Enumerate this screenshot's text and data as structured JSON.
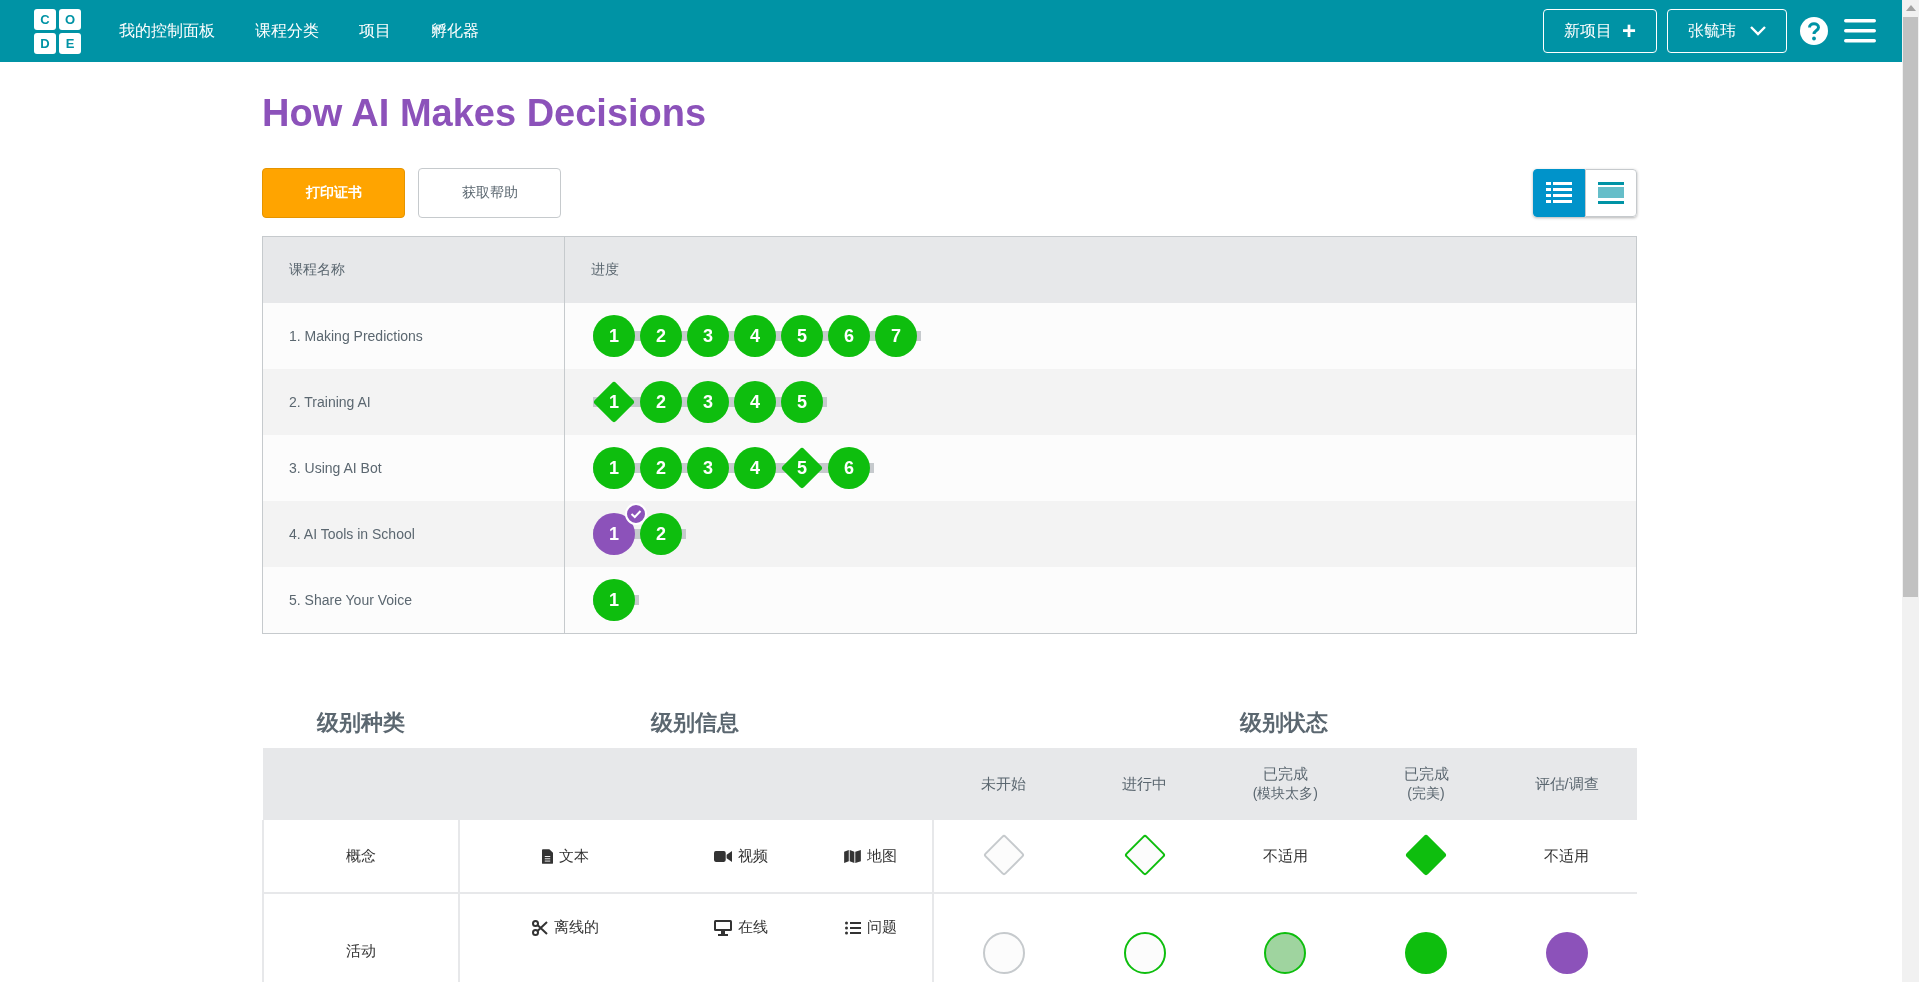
{
  "header": {
    "logo_letters": [
      "C",
      "O",
      "D",
      "E"
    ],
    "nav": [
      "我的控制面板",
      "课程分类",
      "项目",
      "孵化器"
    ],
    "new_project": {
      "label": "新项目",
      "icon": "+"
    },
    "user": {
      "label": "张毓玮"
    }
  },
  "title": "How AI Makes Decisions",
  "actions": {
    "print": "打印证书",
    "help": "获取帮助"
  },
  "view_toggle": [
    {
      "kind": "detail",
      "selected": true
    },
    {
      "kind": "summary",
      "selected": false
    }
  ],
  "progress_table": {
    "columns": [
      "课程名称",
      "进度"
    ],
    "lessons": [
      {
        "name": "1. Making Predictions",
        "levels": [
          {
            "number": "1",
            "kind": "circle",
            "color": "#0ebe0e",
            "checked": false
          },
          {
            "number": "2",
            "kind": "circle",
            "color": "#0ebe0e",
            "checked": false
          },
          {
            "number": "3",
            "kind": "circle",
            "color": "#0ebe0e",
            "checked": false
          },
          {
            "number": "4",
            "kind": "circle",
            "color": "#0ebe0e",
            "checked": false
          },
          {
            "number": "5",
            "kind": "circle",
            "color": "#0ebe0e",
            "checked": false
          },
          {
            "number": "6",
            "kind": "circle",
            "color": "#0ebe0e",
            "checked": false
          },
          {
            "number": "7",
            "kind": "circle",
            "color": "#0ebe0e",
            "checked": false
          }
        ]
      },
      {
        "name": "2. Training AI",
        "levels": [
          {
            "number": "1",
            "kind": "diamond",
            "color": "#0ebe0e",
            "checked": false
          },
          {
            "number": "2",
            "kind": "circle",
            "color": "#0ebe0e",
            "checked": false
          },
          {
            "number": "3",
            "kind": "circle",
            "color": "#0ebe0e",
            "checked": false
          },
          {
            "number": "4",
            "kind": "circle",
            "color": "#0ebe0e",
            "checked": false
          },
          {
            "number": "5",
            "kind": "circle",
            "color": "#0ebe0e",
            "checked": false
          }
        ]
      },
      {
        "name": "3. Using AI Bot",
        "levels": [
          {
            "number": "1",
            "kind": "circle",
            "color": "#0ebe0e",
            "checked": false
          },
          {
            "number": "2",
            "kind": "circle",
            "color": "#0ebe0e",
            "checked": false
          },
          {
            "number": "3",
            "kind": "circle",
            "color": "#0ebe0e",
            "checked": false
          },
          {
            "number": "4",
            "kind": "circle",
            "color": "#0ebe0e",
            "checked": false
          },
          {
            "number": "5",
            "kind": "diamond",
            "color": "#0ebe0e",
            "checked": false
          },
          {
            "number": "6",
            "kind": "circle",
            "color": "#0ebe0e",
            "checked": false
          }
        ]
      },
      {
        "name": "4. AI Tools in School",
        "levels": [
          {
            "number": "1",
            "kind": "circle",
            "color": "#8c52ba",
            "checked": true
          },
          {
            "number": "2",
            "kind": "circle",
            "color": "#0ebe0e",
            "checked": false
          }
        ]
      },
      {
        "name": "5. Share Your Voice",
        "levels": [
          {
            "number": "1",
            "kind": "circle",
            "color": "#0ebe0e",
            "checked": false
          }
        ]
      }
    ]
  },
  "legend": {
    "headings": [
      "级别种类",
      "级别信息",
      "级别状态"
    ],
    "status_columns": [
      {
        "label": "未开始"
      },
      {
        "label": "进行中"
      },
      {
        "label": "已完成",
        "note": "(模块太多)"
      },
      {
        "label": "已完成",
        "note": "(完美)"
      },
      {
        "label": "评估/调查"
      }
    ],
    "rows": [
      {
        "type": "概念",
        "info": [
          {
            "kind": "document",
            "label": "文本"
          },
          {
            "kind": "video",
            "label": "视频"
          },
          {
            "kind": "map",
            "label": "地图"
          }
        ],
        "statuses": [
          {
            "kind": "diamond"
          },
          {
            "kind": "diamond"
          },
          {
            "kind": "text",
            "text": "不适用"
          },
          {
            "kind": "diamond"
          },
          {
            "kind": "text",
            "text": "不适用"
          }
        ]
      },
      {
        "type": "活动",
        "info": [
          {
            "kind": "offline",
            "label": "离线的"
          },
          {
            "kind": "online",
            "label": "在线"
          },
          {
            "kind": "questions",
            "label": "问题"
          }
        ],
        "statuses": [
          {
            "kind": "circle"
          },
          {
            "kind": "circle"
          },
          {
            "kind": "circle"
          },
          {
            "kind": "circle"
          },
          {
            "kind": "circle"
          }
        ]
      }
    ]
  }
}
